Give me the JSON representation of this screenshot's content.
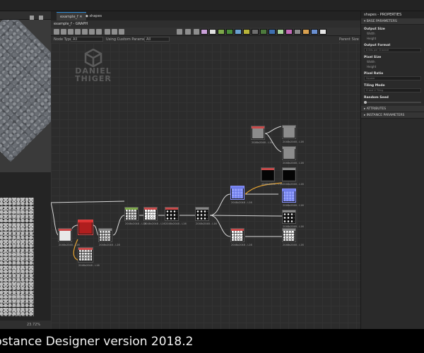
{
  "tabs": [
    {
      "label": "example_f",
      "active": true
    },
    {
      "label": "shapes",
      "active": false
    }
  ],
  "graph_title": "example_f - GRAPH",
  "filter": {
    "node_type_label": "Node Type",
    "node_type_value": "All",
    "params_label": "Using Custom Parameters",
    "params_value": "All",
    "parent_size": "Parent Size :"
  },
  "watermark": {
    "line1": "DANIEL",
    "line2": "THIGER"
  },
  "nodes": [
    {
      "id": "n1",
      "caption": "2048x2048 - L16"
    },
    {
      "id": "n2",
      "caption": "2048x2048 - L16"
    },
    {
      "id": "n3",
      "caption": "2048x2048 - L16"
    },
    {
      "id": "n4",
      "caption": "2048x2048 - L16"
    },
    {
      "id": "n5",
      "caption": "2048x2048 - L16"
    },
    {
      "id": "n6",
      "caption": "2048x2048 - L16"
    },
    {
      "id": "n7",
      "caption": "2048x2048 - L16"
    },
    {
      "id": "n8",
      "caption": "2048x2048 - L16"
    },
    {
      "id": "n9",
      "caption": "2048x2048 - L16"
    },
    {
      "id": "n10",
      "caption": "2048x2048 - L16"
    },
    {
      "id": "n11",
      "caption": "2048x2048 - L16"
    },
    {
      "id": "n12",
      "caption": "2048x2048 - L16"
    },
    {
      "id": "n13",
      "caption": "2048x2048 - L16"
    },
    {
      "id": "n14",
      "caption": "2048x2048 - L16"
    },
    {
      "id": "n15",
      "caption": "2048x2048 - L16"
    },
    {
      "id": "n16",
      "caption": "2048x2048 - L16"
    },
    {
      "id": "n17",
      "caption": "2048x2048 - L16"
    }
  ],
  "left_status": {
    "zoom": "23.72%"
  },
  "properties": {
    "title": "shapes - PROPERTIES",
    "sections": {
      "base": "BASE PARAMETERS",
      "attributes": "ATTRIBUTES",
      "instance": "INSTANCE PARAMETERS"
    },
    "output_size": "Output Size",
    "width": "Width",
    "height": "Height",
    "output_format": "Output Format",
    "output_format_value": "8 Bits per Channel",
    "pixel_size": "Pixel Size",
    "pixel_ratio": "Pixel Ratio",
    "pixel_ratio_value": "Square",
    "tiling_mode": "Tiling Mode",
    "tiling_mode_value": "H and V Tiling",
    "random_seed": "Random Seed"
  },
  "caption": "bstance Designer version 2018.2",
  "colors": {
    "accent": "#2e8bd6",
    "link_orange": "#e8a531",
    "node_red": "#b01e1e",
    "node_green": "#7da84a"
  }
}
